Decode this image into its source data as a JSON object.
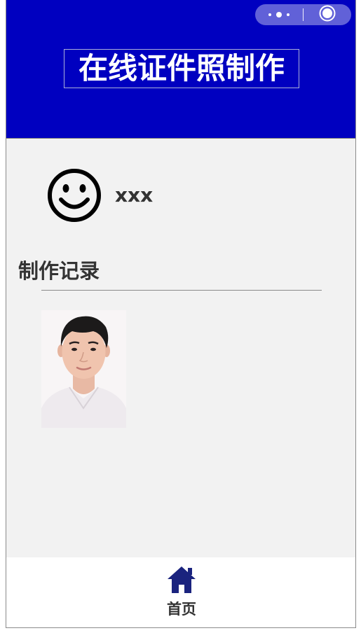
{
  "header": {
    "title": "在线证件照制作",
    "background_color": "#0000c0",
    "capsule": {
      "more_icon": "more-dots-icon",
      "close_icon": "target-close-icon"
    }
  },
  "profile": {
    "avatar_icon": "smiley-face-icon",
    "username": "xxx"
  },
  "records": {
    "section_title": "制作记录",
    "items": [
      {
        "icon": "id-photo-thumbnail"
      }
    ]
  },
  "tabbar": {
    "items": [
      {
        "label": "首页",
        "icon": "home-icon",
        "color": "#1a237e"
      }
    ]
  },
  "colors": {
    "page_background": "#f2f2f2",
    "text_dark": "#333333"
  }
}
